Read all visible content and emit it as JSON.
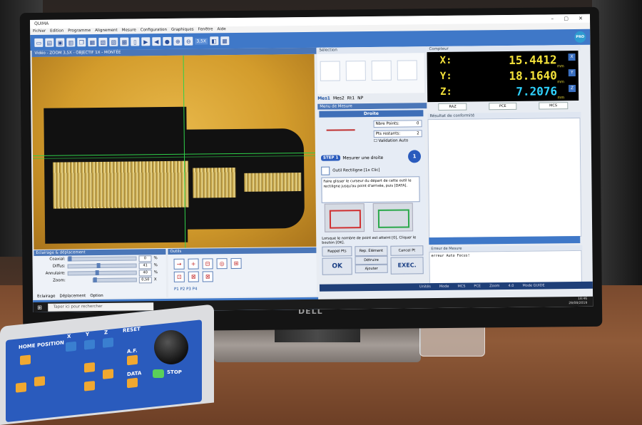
{
  "app": {
    "title": "QUIMA",
    "menu": [
      "Fichier",
      "Edition",
      "Programme",
      "Alignement",
      "Mesure",
      "Configuration",
      "Graphiques",
      "Fenêtre",
      "Aide"
    ],
    "zoom": "3,5X",
    "badge": "PRO"
  },
  "camera": {
    "panel_title": "Vidéo - ZOOM 3,5X - OBJECTIF 1X - MONTÉE"
  },
  "lighting": {
    "title": "Eclairage & déplacement",
    "rows": [
      {
        "label": "Coaxial:",
        "value": "0",
        "unit": "%"
      },
      {
        "label": "Diffus:",
        "value": "41",
        "unit": "%"
      },
      {
        "label": "Annulaire:",
        "value": "40",
        "unit": "%"
      },
      {
        "label": "Zoom:",
        "value": "0,50",
        "unit": "X"
      }
    ],
    "tabs": [
      "Eclairage",
      "Déplacement",
      "Option"
    ]
  },
  "tools": {
    "title": "Outils",
    "tabs": "P1 P2 P3 P4"
  },
  "palette": {
    "title": "Sélection",
    "tabs": [
      "Mes1",
      "Mes2",
      "Rt1",
      "NP"
    ]
  },
  "measure": {
    "panel_title": "Menu de Mesure",
    "header": "Droite",
    "max_points_label": "Nbre Points:",
    "max_points_value": "0",
    "remaining_label": "Pts restants:",
    "remaining_value": "2",
    "auto_label": "Validation Auto",
    "step_badge": "STEP 1",
    "step_text": "Mesurer une droite",
    "step_num": "1",
    "tool_text": "Outil Rectiligne [1x Clic]",
    "instruction": "Faire glisser le curseur du départ de cette outil le rectiligne jusqu'au point d'arrivée, puis [DATA].",
    "note": "Lorsque le nombre de point est atteint [0], Cliquer le bouton [OK].",
    "buttons": {
      "rappel": "Rappel Pts",
      "rep": "Rep. Élément",
      "cancel": "Cancel Pt",
      "delete": "Détruire",
      "add": "Ajouter",
      "ok": "OK",
      "exec": "EXEC."
    }
  },
  "dro": {
    "title": "Compteur",
    "x_label": "X:",
    "x_value": "15.4412",
    "y_label": "Y:",
    "y_value": "18.1640",
    "z_label": "Z:",
    "z_value": "7.2076",
    "unit": "mm",
    "buttons": [
      "RAZ",
      "PCE",
      "MCS"
    ],
    "colors": {
      "x": "#f4e23a",
      "y": "#f4e23a",
      "z": "#2fd3ff"
    }
  },
  "results": {
    "title": "Résultat de conformité"
  },
  "error": {
    "title": "Erreur de Mesure",
    "text": "erreur Auto Focus!"
  },
  "status": {
    "items": [
      "Unités",
      "Mode",
      "MCS",
      "PCE",
      "Zoom",
      "4.0"
    ],
    "mode": "Mode GUIDE"
  },
  "taskbar": {
    "search_placeholder": "Taper ici pour rechercher",
    "time": "18:46",
    "date": "28/08/2019"
  },
  "monitor": {
    "brand": "DELL"
  },
  "keypad": {
    "labels": [
      "HOME POSITION",
      "X",
      "Y",
      "Z",
      "RESET",
      "A.F.",
      "DATA",
      "STOP"
    ]
  }
}
